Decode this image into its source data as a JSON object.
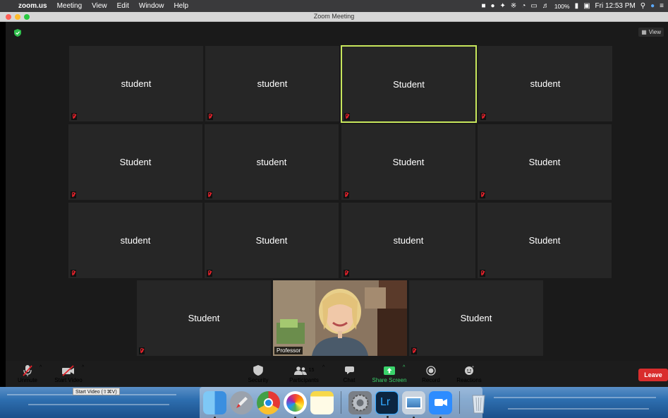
{
  "menubar": {
    "app_name": "zoom.us",
    "menus": [
      "Meeting",
      "View",
      "Edit",
      "Window",
      "Help"
    ],
    "battery": "100%",
    "clock": "Fri 12:53 PM",
    "icons": [
      "zoom-status-icon",
      "creative-cloud-icon",
      "alfred-icon",
      "bluetooth-icon",
      "wifi-icon",
      "airplay-icon",
      "volume-icon",
      "battery-icon",
      "keyboard-input-icon",
      "spotlight-icon",
      "siri-icon",
      "notification-center-icon"
    ]
  },
  "window": {
    "title": "Zoom Meeting",
    "view_label": "View"
  },
  "participants": {
    "rows": [
      [
        "student",
        "student",
        "Student",
        "student"
      ],
      [
        "Student",
        "student",
        "Student",
        "Student"
      ],
      [
        "student",
        "Student",
        "student",
        "Student"
      ],
      [
        "Student",
        "Professor",
        "Student"
      ]
    ],
    "video_participant": "Professor",
    "active_speaker_index": 2
  },
  "toolbar": {
    "unmute": "Unmute",
    "start_video": "Start Video",
    "security": "Security",
    "participants": "Participants",
    "participant_count": "15",
    "chat": "Chat",
    "share_screen": "Share Screen",
    "record": "Record",
    "reactions": "Reactions",
    "leave": "Leave",
    "tooltip": "Start Video (⇧⌘V)"
  },
  "colors": {
    "speaker_border": "#c7e65c",
    "share_green": "#3ad36b",
    "leave_red": "#d92d2d",
    "mute_red": "#e0212a"
  },
  "dock": {
    "apps": [
      "finder-icon",
      "launchpad-icon",
      "chrome-icon",
      "photos-icon",
      "notes-icon",
      "system-preferences-icon",
      "lightroom-icon",
      "preview-icon",
      "zoom-icon",
      "trash-icon"
    ],
    "lightroom_label": "Lr"
  }
}
